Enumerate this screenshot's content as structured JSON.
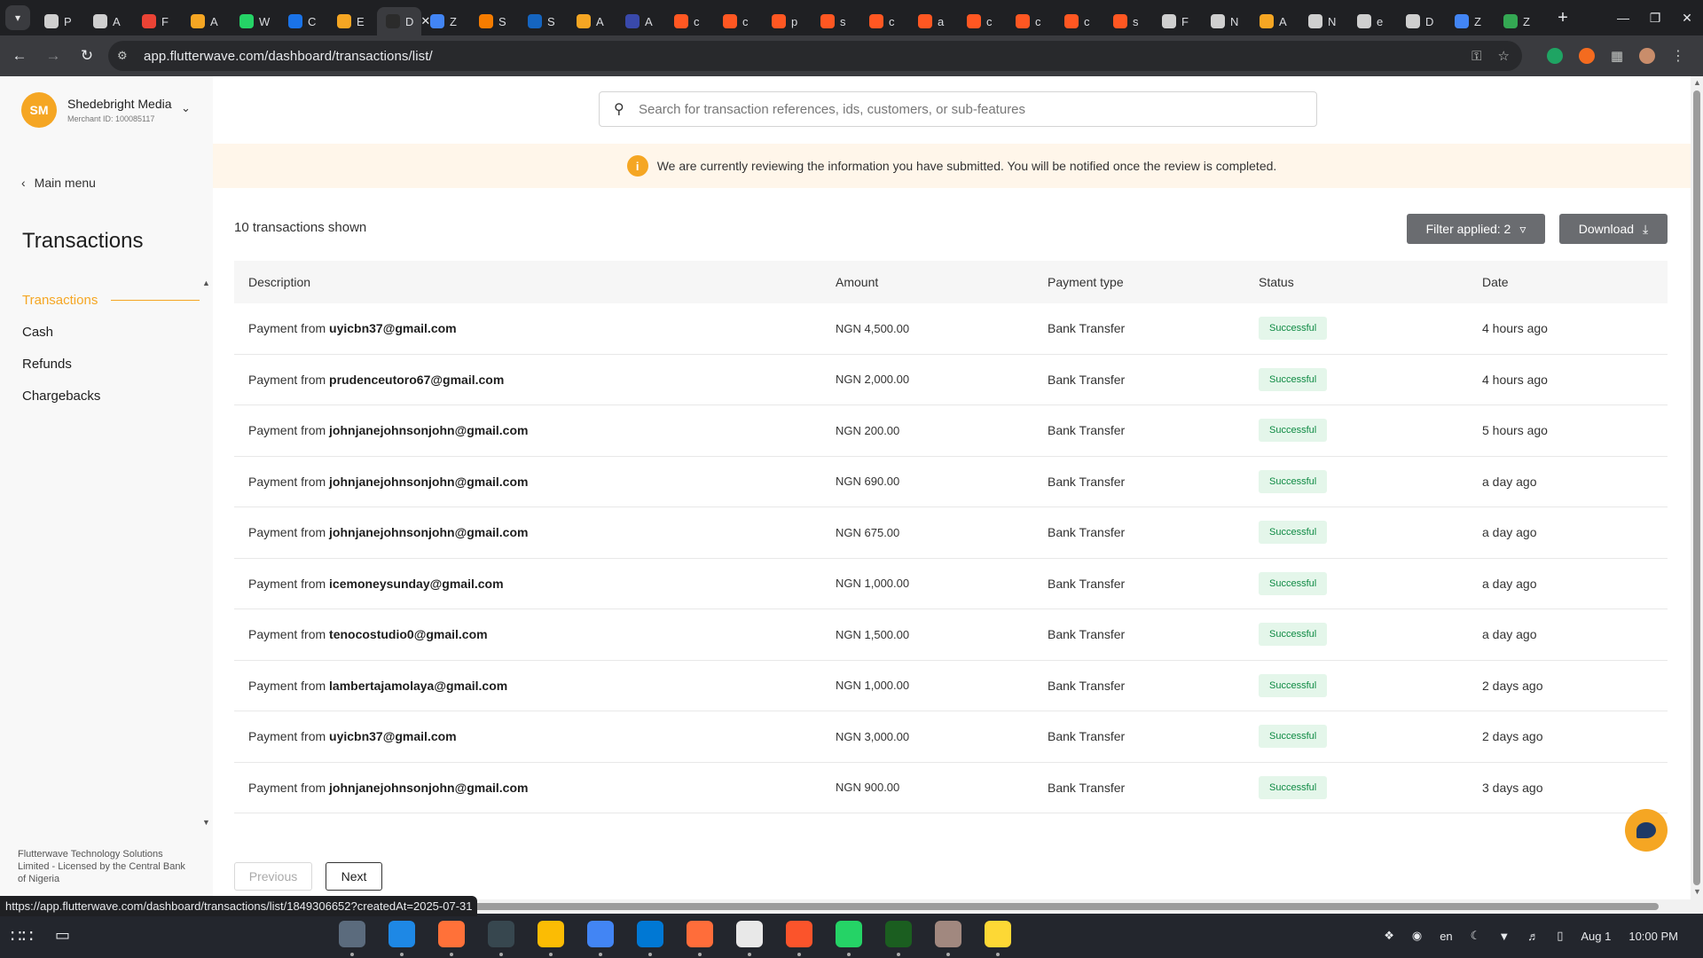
{
  "browser": {
    "tabs": [
      {
        "label": "P",
        "color": "#cfcfcf"
      },
      {
        "label": "A",
        "color": "#cfcfcf"
      },
      {
        "label": "F",
        "color": "#ea4335"
      },
      {
        "label": "A",
        "color": "#f5a623"
      },
      {
        "label": "W",
        "color": "#25d366"
      },
      {
        "label": "C",
        "color": "#1a73e8"
      },
      {
        "label": "E",
        "color": "#f5a623"
      },
      {
        "label": "D",
        "color": "#2b2b2b"
      },
      {
        "label": "Z",
        "color": "#4285f4"
      },
      {
        "label": "S",
        "color": "#f57c00"
      },
      {
        "label": "S",
        "color": "#1565c0"
      },
      {
        "label": "A",
        "color": "#f5a623"
      },
      {
        "label": "A",
        "color": "#3949ab"
      },
      {
        "label": "c",
        "color": "#ff5722"
      },
      {
        "label": "c",
        "color": "#ff5722"
      },
      {
        "label": "p",
        "color": "#ff5722"
      },
      {
        "label": "s",
        "color": "#ff5722"
      },
      {
        "label": "c",
        "color": "#ff5722"
      },
      {
        "label": "a",
        "color": "#ff5722"
      },
      {
        "label": "c",
        "color": "#ff5722"
      },
      {
        "label": "c",
        "color": "#ff5722"
      },
      {
        "label": "c",
        "color": "#ff5722"
      },
      {
        "label": "s",
        "color": "#ff5722"
      },
      {
        "label": "F",
        "color": "#cfcfcf"
      },
      {
        "label": "N",
        "color": "#cfcfcf"
      },
      {
        "label": "A",
        "color": "#f5a623"
      },
      {
        "label": "N",
        "color": "#cfcfcf"
      },
      {
        "label": "e",
        "color": "#cfcfcf"
      },
      {
        "label": "D",
        "color": "#cfcfcf"
      },
      {
        "label": "Z",
        "color": "#4285f4"
      },
      {
        "label": "Z",
        "color": "#34a853"
      }
    ],
    "active_tab_index": 7,
    "url": "app.flutterwave.com/dashboard/transactions/list/",
    "status_url": "https://app.flutterwave.com/dashboard/transactions/list/1849306652?createdAt=2025-07-31"
  },
  "sidebar": {
    "avatar_initials": "SM",
    "merchant_name": "Shedebright Media",
    "merchant_id": "Merchant ID: 100085117",
    "main_menu": "Main menu",
    "section_title": "Transactions",
    "items": [
      {
        "label": "Transactions",
        "active": true
      },
      {
        "label": "Cash",
        "active": false
      },
      {
        "label": "Refunds",
        "active": false
      },
      {
        "label": "Chargebacks",
        "active": false
      }
    ],
    "footer": "Flutterwave Technology Solutions Limited - Licensed by the Central Bank of Nigeria"
  },
  "search": {
    "placeholder": "Search for transaction references, ids, customers, or sub-features"
  },
  "banner": {
    "icon": "i",
    "text": "We are currently reviewing the information you have submitted. You will be notified once the review is completed."
  },
  "toolbar": {
    "count_text": "10 transactions shown",
    "filter_label": "Filter applied: 2",
    "download_label": "Download"
  },
  "table": {
    "headers": [
      "Description",
      "Amount",
      "Payment type",
      "Status",
      "Date"
    ],
    "rows": [
      {
        "prefix": "Payment from",
        "email": "uyicbn37@gmail.com",
        "amount": "NGN 4,500.00",
        "type": "Bank Transfer",
        "status": "Successful",
        "date": "4 hours ago"
      },
      {
        "prefix": "Payment from",
        "email": "prudenceutoro67@gmail.com",
        "amount": "NGN 2,000.00",
        "type": "Bank Transfer",
        "status": "Successful",
        "date": "4 hours ago"
      },
      {
        "prefix": "Payment from",
        "email": "johnjanejohnsonjohn@gmail.com",
        "amount": "NGN 200.00",
        "type": "Bank Transfer",
        "status": "Successful",
        "date": "5 hours ago"
      },
      {
        "prefix": "Payment from",
        "email": "johnjanejohnsonjohn@gmail.com",
        "amount": "NGN 690.00",
        "type": "Bank Transfer",
        "status": "Successful",
        "date": "a day ago"
      },
      {
        "prefix": "Payment from",
        "email": "johnjanejohnsonjohn@gmail.com",
        "amount": "NGN 675.00",
        "type": "Bank Transfer",
        "status": "Successful",
        "date": "a day ago"
      },
      {
        "prefix": "Payment from",
        "email": "icemoneysunday@gmail.com",
        "amount": "NGN 1,000.00",
        "type": "Bank Transfer",
        "status": "Successful",
        "date": "a day ago"
      },
      {
        "prefix": "Payment from",
        "email": "tenocostudio0@gmail.com",
        "amount": "NGN 1,500.00",
        "type": "Bank Transfer",
        "status": "Successful",
        "date": "a day ago"
      },
      {
        "prefix": "Payment from",
        "email": "lambertajamolaya@gmail.com",
        "amount": "NGN 1,000.00",
        "type": "Bank Transfer",
        "status": "Successful",
        "date": "2 days ago"
      },
      {
        "prefix": "Payment from",
        "email": "uyicbn37@gmail.com",
        "amount": "NGN 3,000.00",
        "type": "Bank Transfer",
        "status": "Successful",
        "date": "2 days ago"
      },
      {
        "prefix": "Payment from",
        "email": "johnjanejohnsonjohn@gmail.com",
        "amount": "NGN 900.00",
        "type": "Bank Transfer",
        "status": "Successful",
        "date": "3 days ago"
      }
    ]
  },
  "pager": {
    "previous": "Previous",
    "next": "Next"
  },
  "taskbar": {
    "apps": [
      {
        "name": "files",
        "color": "#5b6b7d"
      },
      {
        "name": "store",
        "color": "#1e88e5"
      },
      {
        "name": "firefox",
        "color": "#ff7139"
      },
      {
        "name": "terminal",
        "color": "#37474f"
      },
      {
        "name": "keep",
        "color": "#fbbc04"
      },
      {
        "name": "chrome",
        "color": "#4285f4"
      },
      {
        "name": "vscode",
        "color": "#0078d4"
      },
      {
        "name": "pen",
        "color": "#ff6d3a"
      },
      {
        "name": "slack",
        "color": "#e8e8e8"
      },
      {
        "name": "brave",
        "color": "#fb542b"
      },
      {
        "name": "whatsapp",
        "color": "#25d366"
      },
      {
        "name": "monitor",
        "color": "#1b5e20"
      },
      {
        "name": "app",
        "color": "#a1887f"
      },
      {
        "name": "notes",
        "color": "#fdd835"
      }
    ],
    "lang": "en",
    "date": "Aug 1",
    "time": "10:00 PM"
  },
  "colors": {
    "accent": "#f5a623",
    "success_bg": "#e4f6ea",
    "success_fg": "#0e8a43"
  }
}
